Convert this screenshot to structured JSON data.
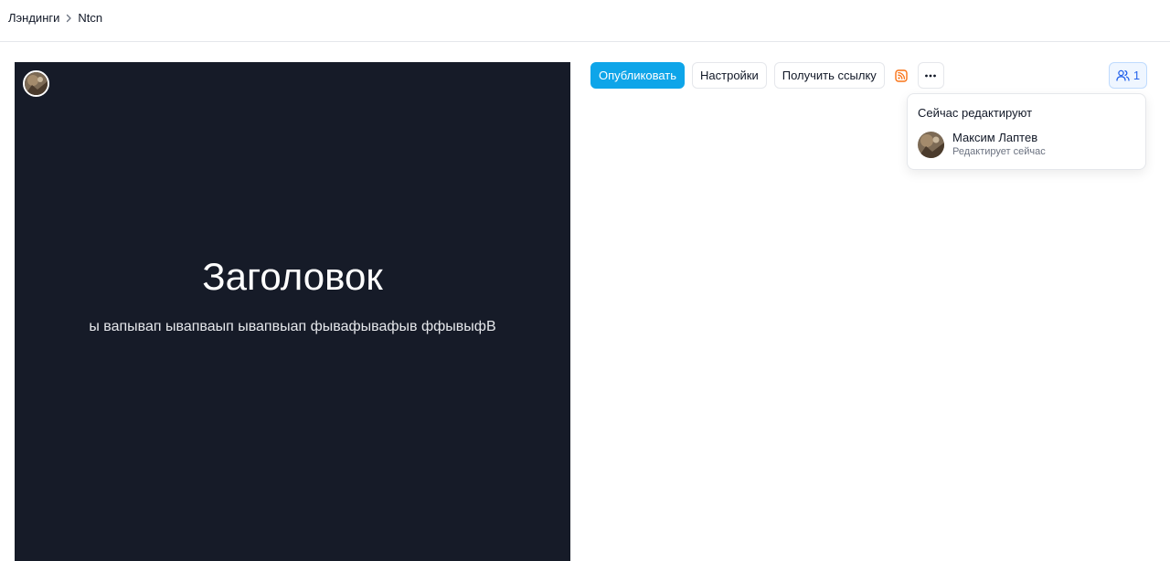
{
  "breadcrumb": {
    "items": [
      "Лэндинги",
      "Ntcn"
    ]
  },
  "preview": {
    "title": "Заголовок",
    "subtitle": "ы вапывап ывапваып ывапвыап фывафывафыв ффывыфВ",
    "background": "#161b28"
  },
  "toolbar": {
    "publish_label": "Опубликовать",
    "settings_label": "Настройки",
    "get_link_label": "Получить ссылку",
    "rss_icon": "rss-icon",
    "more_icon": "more-horizontal-icon"
  },
  "collaborators": {
    "count": "1",
    "icon": "users-icon"
  },
  "popover": {
    "title": "Сейчас редактируют",
    "editors": [
      {
        "name": "Максим Лаптев",
        "status": "Редактирует сейчас"
      }
    ]
  },
  "colors": {
    "accent": "#0ea5e9",
    "rss": "#f97316",
    "collab": "#2563eb"
  }
}
